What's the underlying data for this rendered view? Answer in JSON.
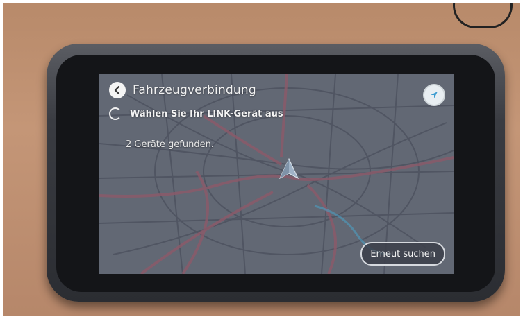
{
  "header": {
    "title": "Fahrzeugverbindung",
    "back_icon": "back-arrow-icon",
    "nav_icon": "navigation-arrow-icon"
  },
  "status": {
    "spinner_icon": "loading-spinner-icon",
    "text": "Wählen Sie Ihr LINK-Gerät aus"
  },
  "result": {
    "text": "2 Geräte gefunden."
  },
  "actions": {
    "research_label": "Erneut suchen"
  },
  "colors": {
    "accent": "#4aa3c8",
    "screen_bg": "#5f6470",
    "road_primary": "#8a5a6a",
    "road_secondary": "#4d5260"
  }
}
